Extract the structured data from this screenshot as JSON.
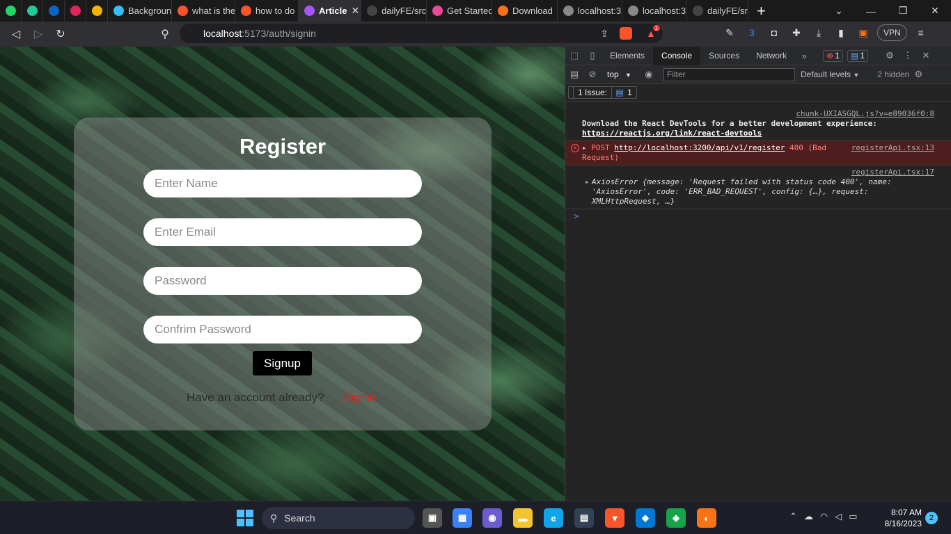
{
  "browser": {
    "tabs": [
      {
        "label": "",
        "icon": "whatsapp-icon",
        "color": "#25d366",
        "pinned": true
      },
      {
        "label": "",
        "icon": "feather-icon",
        "color": "#20c997",
        "pinned": true
      },
      {
        "label": "",
        "icon": "linkedin-icon",
        "color": "#0a66c2",
        "pinned": true
      },
      {
        "label": "",
        "icon": "react-icon",
        "color": "#e0245e",
        "pinned": true
      },
      {
        "label": "",
        "icon": "zb-icon",
        "color": "#f4b400",
        "pinned": true
      },
      {
        "label": "Backgroun",
        "icon": "tailwind-icon",
        "color": "#38bdf8"
      },
      {
        "label": "what is the",
        "icon": "brave-icon",
        "color": "#fb542b"
      },
      {
        "label": "how to do",
        "icon": "brave-icon",
        "color": "#fb542b"
      },
      {
        "label": "Article",
        "icon": "vite-icon",
        "color": "#a855f7",
        "active": true
      },
      {
        "label": "dailyFE/src",
        "icon": "github-icon",
        "color": "#444444"
      },
      {
        "label": "Get Startec",
        "icon": "app-icon",
        "color": "#ec4899"
      },
      {
        "label": "Download",
        "icon": "download-brand-icon",
        "color": "#f97316"
      },
      {
        "label": "localhost:3",
        "icon": "globe-icon",
        "color": "#888888"
      },
      {
        "label": "localhost:3",
        "icon": "globe-icon",
        "color": "#888888"
      },
      {
        "label": "dailyFE/src",
        "icon": "github-icon",
        "color": "#444444"
      }
    ],
    "new_tab": "+",
    "url_host": "localhost",
    "url_path": ":5173/auth/signin",
    "brave_badge": "1",
    "vpn": "VPN"
  },
  "form": {
    "title": "Register",
    "name_placeholder": "Enter Name",
    "email_placeholder": "Enter Email",
    "password_placeholder": "Password",
    "confirm_placeholder": "Confrim Password",
    "signup_label": "Signup",
    "have_account": "Have an account already?",
    "signin_label": "Signin"
  },
  "devtools": {
    "tabs": [
      "Elements",
      "Console",
      "Sources",
      "Network"
    ],
    "active_tab": "Console",
    "error_count": "1",
    "message_count": "1",
    "context": "top",
    "filter_placeholder": "Filter",
    "levels": "Default levels",
    "hidden": "2 hidden",
    "issues_label": "1 Issue:",
    "issues_count": "1",
    "messages": [
      {
        "source": "chunk-UXIASGQL.js?v=e89036f0:8",
        "text": "Download the React DevTools for a better development experience: ",
        "link": "https://reactjs.org/link/react-devtools"
      },
      {
        "source": "registerApi.tsx:13",
        "method": "POST",
        "url": "http://localhost:3200/api/v1/register",
        "status": "400 (Bad Request)"
      },
      {
        "source": "registerApi.tsx:17",
        "text": "AxiosError {message: 'Request failed with status code 400', name: 'AxiosError', code: 'ERR_BAD_REQUEST', config: {…}, request: XMLHttpRequest, …}"
      }
    ],
    "prompt": ">"
  },
  "taskbar": {
    "search": "Search",
    "time": "8:07 AM",
    "date": "8/16/2023",
    "notifications": "2"
  }
}
